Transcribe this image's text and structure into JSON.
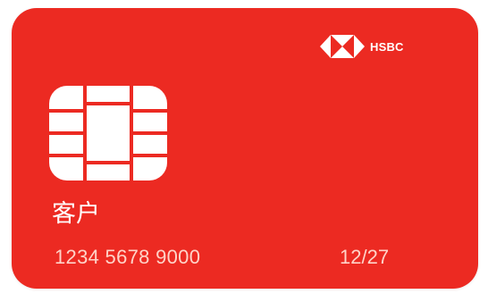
{
  "card": {
    "brand": "HSBC",
    "holder": "客户",
    "number": "1234 5678 9000",
    "expiry": "12/27",
    "colors": {
      "background": "#ec2a22",
      "text": "#ffffff",
      "muted_text": "#ffd3c8"
    },
    "icons": {
      "logo": "hsbc-hexagon-logo-icon",
      "chip": "emv-chip-icon"
    }
  }
}
